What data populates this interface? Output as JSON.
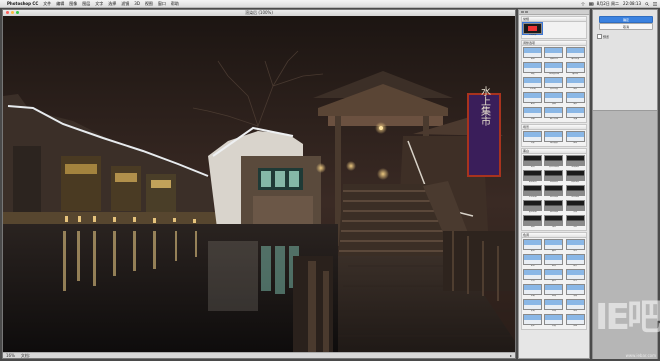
{
  "menubar": {
    "app_name": "Photoshop CC",
    "menus": [
      "文件",
      "编辑",
      "图像",
      "图层",
      "文字",
      "选择",
      "滤镜",
      "3D",
      "视图",
      "窗口",
      "帮助"
    ],
    "status_text": "8月2日 周二",
    "time": "22:08:13"
  },
  "document": {
    "title": "渲染后 (100%)",
    "sign_text": "水上集市",
    "zoom": "16%",
    "doc_info": "文档:"
  },
  "presets_panel": {
    "groups": [
      {
        "title": "常规",
        "items": [
          "原始图像"
        ]
      },
      {
        "title": "调整选项",
        "items": [
          "提亮",
          "调整对比",
          "曝光过度",
          "亮度",
          "饱和度增强",
          "暖色调",
          "冷色调",
          "高对比度",
          "黑白",
          "复古",
          "清晰",
          "柔和",
          "降噪",
          "细节增强",
          "渐变"
        ]
      },
      {
        "title": "场景",
        "items": [
          "风景",
          "城市夜景",
          "建筑"
        ]
      },
      {
        "title": "黑白",
        "items": [
          "黑白",
          "高对比黑白",
          "低调黑白",
          "柔和黑白",
          "经典黑白",
          "颗粒黑白",
          "红色滤镜",
          "蓝色滤镜",
          "绿色滤镜",
          "黄色滤镜",
          "橙色滤镜",
          "高调",
          "暗角",
          "深色",
          "浅色"
        ]
      },
      {
        "title": "色调",
        "items": [
          "青色",
          "暖色",
          "冷色",
          "金色",
          "复古",
          "胶片",
          "夕阳",
          "晨光",
          "月光",
          "棕褐",
          "蓝调",
          "薄荷",
          "紫调",
          "粉调",
          "琥珀",
          "翡翠",
          "石板",
          "霓虹"
        ]
      }
    ]
  },
  "right_panel": {
    "primary_button": "确定",
    "secondary_button": "取消",
    "checkbox_label": "预览"
  },
  "watermark": {
    "main": "IE吧",
    "sub": "www.iebar.com"
  }
}
